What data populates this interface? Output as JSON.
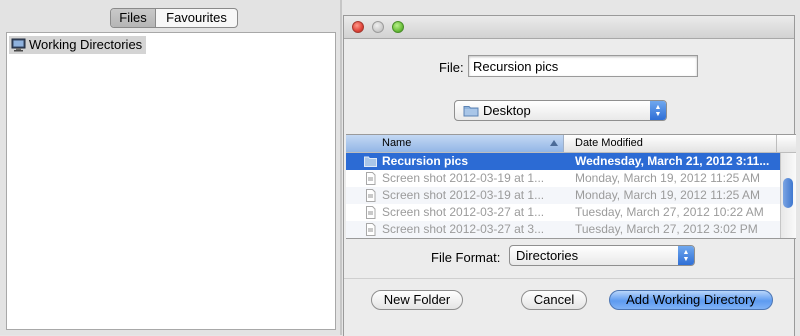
{
  "left_panel": {
    "tabs": [
      {
        "label": "Files",
        "active": true
      },
      {
        "label": "Favourites",
        "active": false
      }
    ],
    "tree": [
      {
        "label": "Working Directories",
        "icon": "computer-icon",
        "selected": true
      }
    ]
  },
  "dialog": {
    "file_label": "File:",
    "file_value": "Recursion pics",
    "location": {
      "label": "Desktop",
      "icon": "folder-icon"
    },
    "browser": {
      "columns": [
        "Name",
        "Date Modified"
      ],
      "rows": [
        {
          "name": "Recursion pics",
          "date": "Wednesday, March 21, 2012 3:11...",
          "icon": "folder-icon",
          "selected": true
        },
        {
          "name": "Screen shot 2012-03-19 at 1...",
          "date": "Monday, March 19, 2012 11:25 AM",
          "icon": "document-icon",
          "selected": false
        },
        {
          "name": "Screen shot 2012-03-19 at 1...",
          "date": "Monday, March 19, 2012 11:25 AM",
          "icon": "document-icon",
          "selected": false
        },
        {
          "name": "Screen shot 2012-03-27 at 1...",
          "date": "Tuesday, March 27, 2012 10:22 AM",
          "icon": "document-icon",
          "selected": false
        },
        {
          "name": "Screen shot 2012-03-27 at 3...",
          "date": "Tuesday, March 27, 2012 3:02 PM",
          "icon": "document-icon",
          "selected": false
        }
      ]
    },
    "file_format_label": "File Format:",
    "file_format_value": "Directories",
    "buttons": {
      "new_folder": "New Folder",
      "cancel": "Cancel",
      "primary": "Add Working Directory"
    }
  },
  "colors": {
    "selection": "#2c6bd4",
    "primary_button": "#5e9bf0",
    "close_button": "#e0443a",
    "zoom_button": "#6cc03c"
  }
}
